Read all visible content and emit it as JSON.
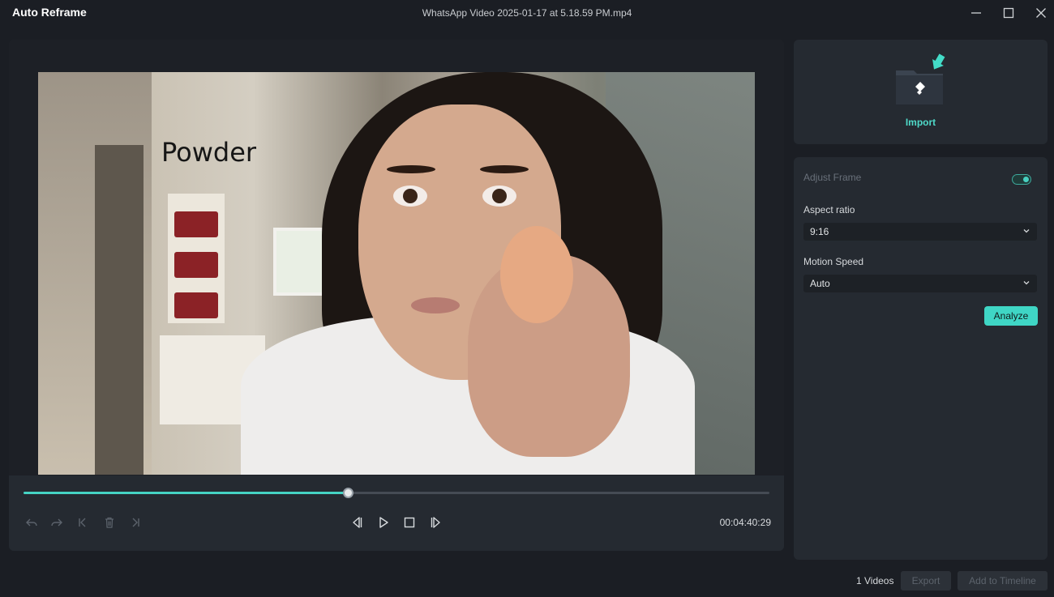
{
  "window": {
    "app_title": "Auto Reframe",
    "file_title": "WhatsApp Video 2025-01-17 at 5.18.59 PM.mp4",
    "controls": [
      "minimize-icon",
      "maximize-icon",
      "close-icon"
    ]
  },
  "preview": {
    "caption_text": "Powder",
    "progress": 0.435,
    "timecode": "00:04:40:29",
    "left_controls": [
      "undo-icon",
      "redo-icon",
      "go-to-start-icon",
      "delete-icon",
      "go-to-end-icon"
    ],
    "center_controls": [
      "previous-frame-icon",
      "play-icon",
      "stop-icon",
      "next-frame-icon"
    ]
  },
  "import": {
    "label": "Import",
    "icon": "import-folder-icon"
  },
  "settings": {
    "adjust_frame_label": "Adjust Frame",
    "adjust_frame_on": true,
    "aspect_ratio_label": "Aspect ratio",
    "aspect_ratio_value": "9:16",
    "motion_speed_label": "Motion Speed",
    "motion_speed_value": "Auto",
    "analyze_label": "Analyze"
  },
  "footer": {
    "video_count": "1 Videos",
    "export_label": "Export",
    "add_to_timeline_label": "Add to Timeline"
  },
  "colors": {
    "accent": "#3fd6c5",
    "background": "#1b1e24",
    "panel": "#252a31"
  }
}
